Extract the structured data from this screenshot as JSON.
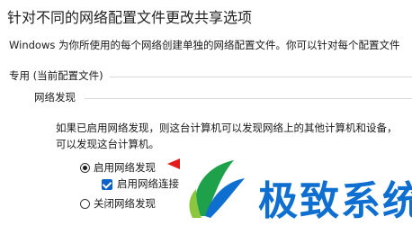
{
  "header": {
    "title": "针对不同的网络配置文件更改共享选项"
  },
  "description": "Windows 为你所使用的每个网络创建单独的网络配置文件。你可以针对每个配置文件",
  "profile": {
    "title": "专用 (当前配置文件)"
  },
  "network_discovery": {
    "title": "网络发现",
    "body_line1": "如果已启用网络发现，则这台计算机可以发现网络上的其他计算机和设备，",
    "body_line2": "可以发现这台计算机。",
    "option_on": {
      "label": "启用网络发现",
      "selected": true
    },
    "option_auto": {
      "label": "启用网络连接",
      "checked": true
    },
    "option_off": {
      "label": "关闭网络发现",
      "selected": false
    }
  },
  "watermark": {
    "text": "极致系统",
    "logo_icon": "leaf-logo-icon"
  },
  "colors": {
    "accent": "#0a62c9",
    "arrow": "#e21b1b",
    "watermark": "#0e6fd0"
  }
}
